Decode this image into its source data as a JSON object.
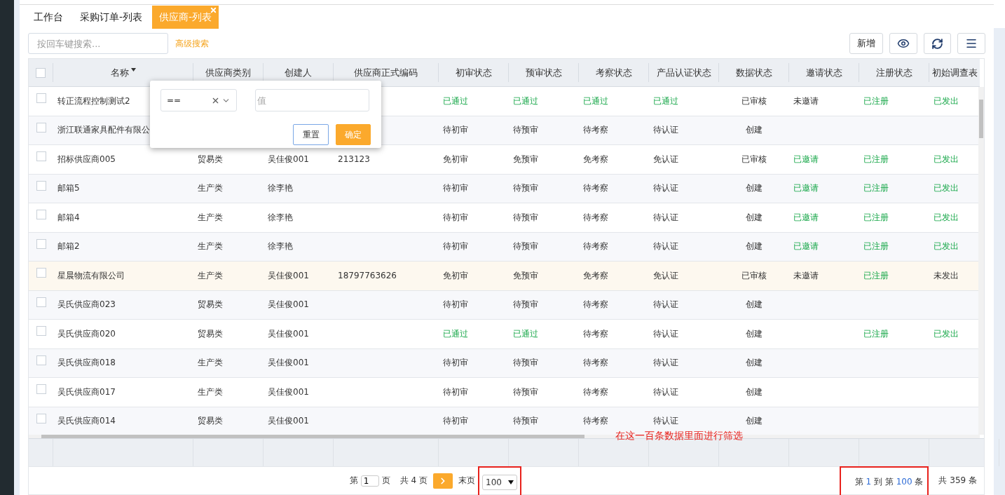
{
  "tabs": [
    {
      "label": "工作台",
      "selected": false,
      "closable": false
    },
    {
      "label": "采购订单-列表",
      "selected": false,
      "closable": false
    },
    {
      "label": "供应商-列表",
      "selected": true,
      "closable": true
    }
  ],
  "search": {
    "placeholder": "按回车键搜索..."
  },
  "advanced_search": "高级搜索",
  "toolbar": {
    "add_button": "新增"
  },
  "table": {
    "all_checked": false,
    "columns": [
      {
        "label": "名称",
        "sorted": true
      },
      {
        "label": "供应商类别",
        "sorted": false
      },
      {
        "label": "创建人",
        "sorted": false
      },
      {
        "label": "供应商正式编码",
        "sorted": false
      },
      {
        "label": "初审状态",
        "sorted": false
      },
      {
        "label": "预审状态",
        "sorted": false
      },
      {
        "label": "考察状态",
        "sorted": false
      },
      {
        "label": "产品认证状态",
        "sorted": false
      },
      {
        "label": "数据状态",
        "sorted": false
      },
      {
        "label": "邀请状态",
        "sorted": false
      },
      {
        "label": "注册状态",
        "sorted": false
      },
      {
        "label": "初始调查表",
        "sorted": false
      }
    ],
    "rows": [
      {
        "highlighted": false,
        "checked": false,
        "name": "转正流程控制测试2",
        "statuses": {
          "first_review": {
            "text": "已通过",
            "green": true
          },
          "pre_review": {
            "text": "已通过",
            "green": true
          },
          "inspection": {
            "text": "已通过",
            "green": true
          },
          "certification": {
            "text": "已通过",
            "green": true
          },
          "data": {
            "text": "已审核",
            "green": false
          },
          "invitation": {
            "text": "未邀请",
            "green": false
          },
          "registration": {
            "text": "已注册",
            "green": true
          },
          "survey": {
            "text": "已发出",
            "green": true
          }
        }
      },
      {
        "highlighted": false,
        "checked": false,
        "name": "浙江联通家具配件有限公",
        "statuses": {
          "first_review": {
            "text": "待初审",
            "green": false
          },
          "pre_review": {
            "text": "待预审",
            "green": false
          },
          "inspection": {
            "text": "待考察",
            "green": false
          },
          "certification": {
            "text": "待认证",
            "green": false
          },
          "data": {
            "text": "创建",
            "green": false
          }
        }
      },
      {
        "highlighted": false,
        "checked": false,
        "name": "招标供应商005",
        "category": "贸易类",
        "creator": "吴佳俊001",
        "code": "213123",
        "statuses": {
          "first_review": {
            "text": "免初审",
            "green": false
          },
          "pre_review": {
            "text": "免预审",
            "green": false
          },
          "inspection": {
            "text": "免考察",
            "green": false
          },
          "certification": {
            "text": "免认证",
            "green": false
          },
          "data": {
            "text": "已审核",
            "green": false
          },
          "invitation": {
            "text": "已邀请",
            "green": true
          },
          "registration": {
            "text": "已注册",
            "green": true
          },
          "survey": {
            "text": "已发出",
            "green": true
          }
        }
      },
      {
        "highlighted": false,
        "checked": false,
        "name": "邮箱5",
        "category": "生产类",
        "creator": "徐李艳",
        "statuses": {
          "first_review": {
            "text": "待初审",
            "green": false
          },
          "pre_review": {
            "text": "待预审",
            "green": false
          },
          "inspection": {
            "text": "待考察",
            "green": false
          },
          "certification": {
            "text": "待认证",
            "green": false
          },
          "data": {
            "text": "创建",
            "green": false
          },
          "invitation": {
            "text": "已邀请",
            "green": true
          },
          "registration": {
            "text": "已注册",
            "green": true
          },
          "survey": {
            "text": "已发出",
            "green": true
          }
        }
      },
      {
        "highlighted": false,
        "checked": false,
        "name": "邮箱4",
        "category": "生产类",
        "creator": "徐李艳",
        "statuses": {
          "first_review": {
            "text": "待初审",
            "green": false
          },
          "pre_review": {
            "text": "待预审",
            "green": false
          },
          "inspection": {
            "text": "待考察",
            "green": false
          },
          "certification": {
            "text": "待认证",
            "green": false
          },
          "data": {
            "text": "创建",
            "green": false
          },
          "invitation": {
            "text": "已邀请",
            "green": true
          },
          "registration": {
            "text": "已注册",
            "green": true
          },
          "survey": {
            "text": "已发出",
            "green": true
          }
        }
      },
      {
        "highlighted": false,
        "checked": false,
        "name": "邮箱2",
        "category": "生产类",
        "creator": "徐李艳",
        "statuses": {
          "first_review": {
            "text": "待初审",
            "green": false
          },
          "pre_review": {
            "text": "待预审",
            "green": false
          },
          "inspection": {
            "text": "待考察",
            "green": false
          },
          "certification": {
            "text": "待认证",
            "green": false
          },
          "data": {
            "text": "创建",
            "green": false
          },
          "invitation": {
            "text": "已邀请",
            "green": true
          },
          "registration": {
            "text": "已注册",
            "green": true
          },
          "survey": {
            "text": "已发出",
            "green": true
          }
        }
      },
      {
        "highlighted": true,
        "checked": false,
        "name": "星晨物流有限公司",
        "category": "生产类",
        "creator": "吴佳俊001",
        "code": "18797763626",
        "statuses": {
          "first_review": {
            "text": "免初审",
            "green": false
          },
          "pre_review": {
            "text": "免预审",
            "green": false
          },
          "inspection": {
            "text": "免考察",
            "green": false
          },
          "certification": {
            "text": "免认证",
            "green": false
          },
          "data": {
            "text": "已审核",
            "green": false
          },
          "invitation": {
            "text": "未邀请",
            "green": false
          },
          "registration": {
            "text": "已注册",
            "green": true
          },
          "survey": {
            "text": "未发出",
            "green": false
          }
        }
      },
      {
        "highlighted": false,
        "checked": false,
        "name": "吴氏供应商023",
        "category": "贸易类",
        "creator": "吴佳俊001",
        "statuses": {
          "first_review": {
            "text": "待初审",
            "green": false
          },
          "pre_review": {
            "text": "待预审",
            "green": false
          },
          "inspection": {
            "text": "待考察",
            "green": false
          },
          "certification": {
            "text": "待认证",
            "green": false
          },
          "data": {
            "text": "创建",
            "green": false
          }
        }
      },
      {
        "highlighted": false,
        "checked": false,
        "name": "吴氏供应商020",
        "category": "贸易类",
        "creator": "吴佳俊001",
        "statuses": {
          "first_review": {
            "text": "已通过",
            "green": true
          },
          "pre_review": {
            "text": "已通过",
            "green": true
          },
          "inspection": {
            "text": "待考察",
            "green": false
          },
          "certification": {
            "text": "待认证",
            "green": false
          },
          "data": {
            "text": "创建",
            "green": false
          },
          "registration": {
            "text": "已注册",
            "green": true
          },
          "survey": {
            "text": "已发出",
            "green": true
          }
        }
      },
      {
        "highlighted": false,
        "checked": false,
        "name": "吴氏供应商018",
        "category": "生产类",
        "creator": "吴佳俊001",
        "statuses": {
          "first_review": {
            "text": "待初审",
            "green": false
          },
          "pre_review": {
            "text": "待预审",
            "green": false
          },
          "inspection": {
            "text": "待考察",
            "green": false
          },
          "certification": {
            "text": "待认证",
            "green": false
          },
          "data": {
            "text": "创建",
            "green": false
          }
        }
      },
      {
        "highlighted": false,
        "checked": false,
        "name": "吴氏供应商017",
        "category": "生产类",
        "creator": "吴佳俊001",
        "statuses": {
          "first_review": {
            "text": "待初审",
            "green": false
          },
          "pre_review": {
            "text": "待预审",
            "green": false
          },
          "inspection": {
            "text": "待考察",
            "green": false
          },
          "certification": {
            "text": "待认证",
            "green": false
          },
          "data": {
            "text": "创建",
            "green": false
          }
        }
      },
      {
        "highlighted": false,
        "checked": false,
        "name": "吴氏供应商014",
        "category": "贸易类",
        "creator": "吴佳俊001",
        "statuses": {
          "first_review": {
            "text": "待初审",
            "green": false
          },
          "pre_review": {
            "text": "待预审",
            "green": false
          },
          "inspection": {
            "text": "待考察",
            "green": false
          },
          "certification": {
            "text": "待认证",
            "green": false
          },
          "data": {
            "text": "创建",
            "green": false
          }
        }
      }
    ]
  },
  "filter_popup": {
    "operator": "==",
    "value_placeholder": "值",
    "reset_button": "重置",
    "confirm_button": "确定"
  },
  "pagination": {
    "page_prefix": "第",
    "page": "1",
    "page_suffix": "页",
    "total_pages": "共 4 页",
    "last": "末页",
    "page_size": "100",
    "range": {
      "prefix": "第",
      "from": "1",
      "middle": "到 第",
      "to": "100",
      "suffix": "条"
    },
    "total": "共 359 条"
  },
  "annotation": {
    "note": "在这一百条数据里面进行筛选"
  }
}
